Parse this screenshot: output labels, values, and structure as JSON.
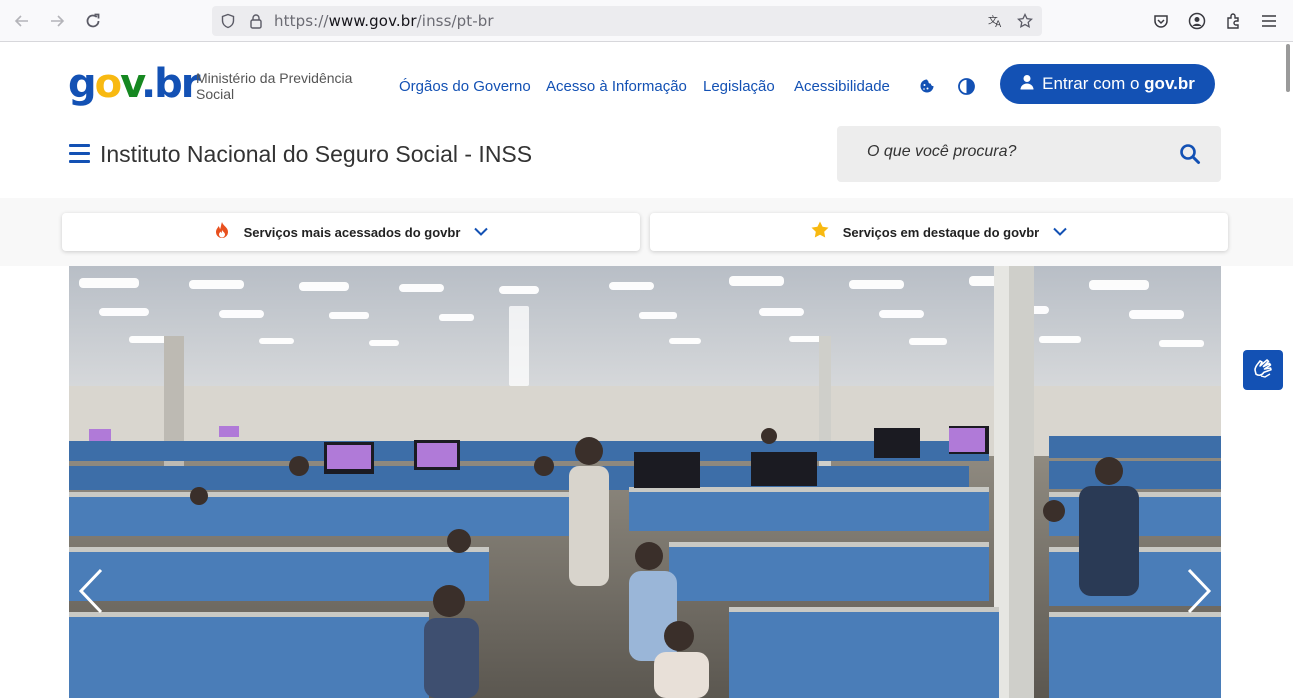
{
  "browser": {
    "url_prefix": "https://",
    "url_domain": "www.gov.br",
    "url_path": "/inss/pt-br"
  },
  "header": {
    "logo": {
      "g": "g",
      "o": "o",
      "v": "v",
      "dot": ".",
      "br": "br"
    },
    "ministry": "Ministério da Previdência Social",
    "links": [
      "Órgãos do Governo",
      "Acesso à Informação",
      "Legislação",
      "Acessibilidade"
    ],
    "login": {
      "prefix": "Entrar com o",
      "brand": "gov.br"
    },
    "site_title": "Instituto Nacional do Seguro Social - INSS",
    "search_placeholder": "O que você procura?"
  },
  "services": {
    "most_accessed": "Serviços mais acessados do govbr",
    "featured": "Serviços em destaque do govbr"
  },
  "icons": {
    "most_accessed": "fire-icon",
    "featured": "star-icon",
    "search": "search-icon",
    "menu": "hamburger-menu-icon",
    "login": "user-icon",
    "vlibras": "sign-language-icon"
  },
  "colors": {
    "primary": "#1351b4",
    "fire": "#e8501e",
    "star": "#f8b911"
  }
}
